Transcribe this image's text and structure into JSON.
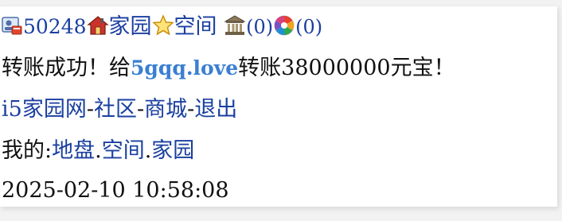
{
  "header": {
    "user_id": "50248",
    "home_link": "家园",
    "space_link": "空间",
    "bank_count": "(0)",
    "album_count": "(0)",
    "icons": [
      "user-card-icon",
      "house-icon",
      "star-icon",
      "bank-icon",
      "aperture-icon"
    ]
  },
  "message": {
    "prefix": "转账成功！给",
    "recipient": "5gqq.love",
    "suffix": "转账38000000元宝！"
  },
  "nav": {
    "site": "i5家园网",
    "sep1": "-",
    "community": "社区",
    "sep2": "-",
    "mall": "商城",
    "sep3": "-",
    "logout": "退出"
  },
  "mine": {
    "label": "我的:",
    "land": "地盘",
    "dot1": ".",
    "space": "空间",
    "dot2": ".",
    "home": "家园"
  },
  "timestamp": "2025-02-10 10:58:08",
  "colors": {
    "link": "#1a3fa0",
    "highlight_link": "#3a7fd1",
    "text": "#111111"
  }
}
